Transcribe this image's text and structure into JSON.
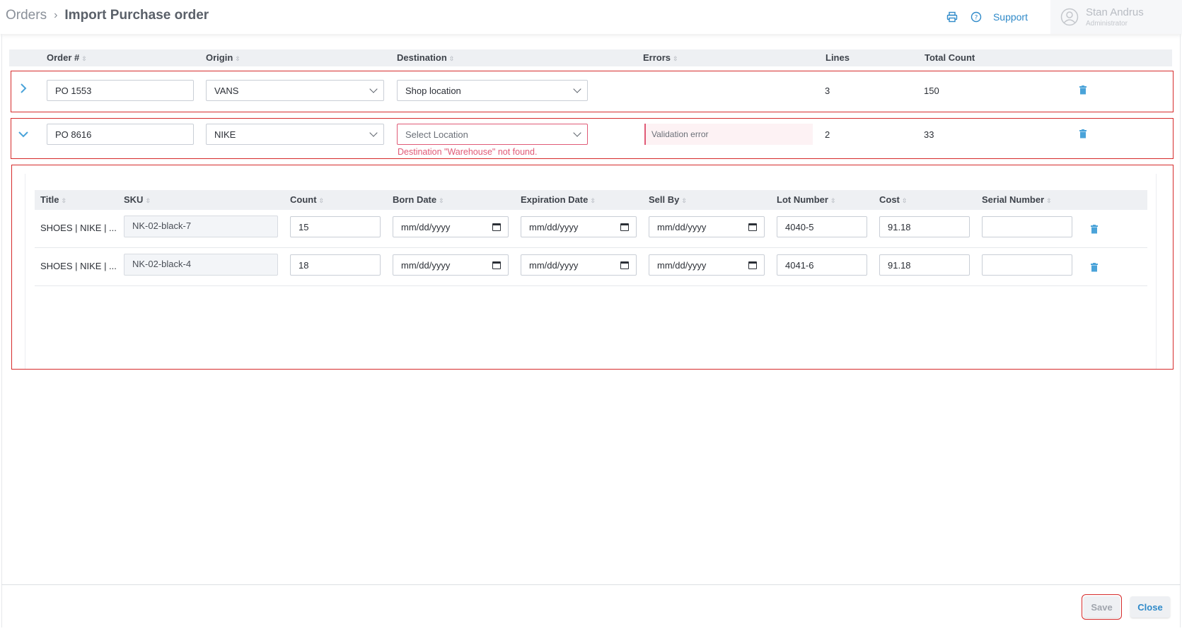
{
  "header": {
    "breadcrumb_root": "Orders",
    "breadcrumb_sep": "›",
    "title": "Import Purchase order",
    "support_label": "Support",
    "user_name": "Stan Andrus",
    "user_role": "Administrator",
    "icons": [
      "printer-icon",
      "help-circle-icon",
      "user-avatar-icon"
    ]
  },
  "orders_table": {
    "columns": [
      "Order #",
      "Origin",
      "Destination",
      "Errors",
      "Lines",
      "Total Count"
    ],
    "sortable": [
      "Order #",
      "Origin",
      "Destination",
      "Errors"
    ],
    "rows": [
      {
        "order": "PO 1553",
        "origin": "VANS",
        "destination": "Shop location",
        "errors": "",
        "lines": "3",
        "total": "150",
        "expanded": false
      },
      {
        "order": "PO 8616",
        "origin": "NIKE",
        "destination": "Select Location",
        "errors": "Validation error",
        "error_message": "Destination \"Warehouse\" not found.",
        "lines": "2",
        "total": "33",
        "expanded": true
      }
    ]
  },
  "lines_table": {
    "columns": [
      "Title",
      "SKU",
      "Count",
      "Born Date",
      "Expiration Date",
      "Sell By",
      "Lot Number",
      "Cost",
      "Serial Number"
    ],
    "rows": [
      {
        "title": "SHOES | NIKE | ...",
        "sku": "NK-02-black-7",
        "count": "15",
        "born": "mm/dd/yyyy",
        "expiration": "mm/dd/yyyy",
        "sell_by": "mm/dd/yyyy",
        "lot": "4040-5",
        "cost": "91.18",
        "serial": ""
      },
      {
        "title": "SHOES | NIKE | ...",
        "sku": "NK-02-black-4",
        "count": "18",
        "born": "mm/dd/yyyy",
        "expiration": "mm/dd/yyyy",
        "sell_by": "mm/dd/yyyy",
        "lot": "4041-6",
        "cost": "91.18",
        "serial": ""
      }
    ]
  },
  "footer": {
    "save_label": "Save",
    "close_label": "Close"
  },
  "colors": {
    "accent": "#2f8ac9",
    "error": "#e05a76",
    "highlight_border": "#d62b2b"
  }
}
